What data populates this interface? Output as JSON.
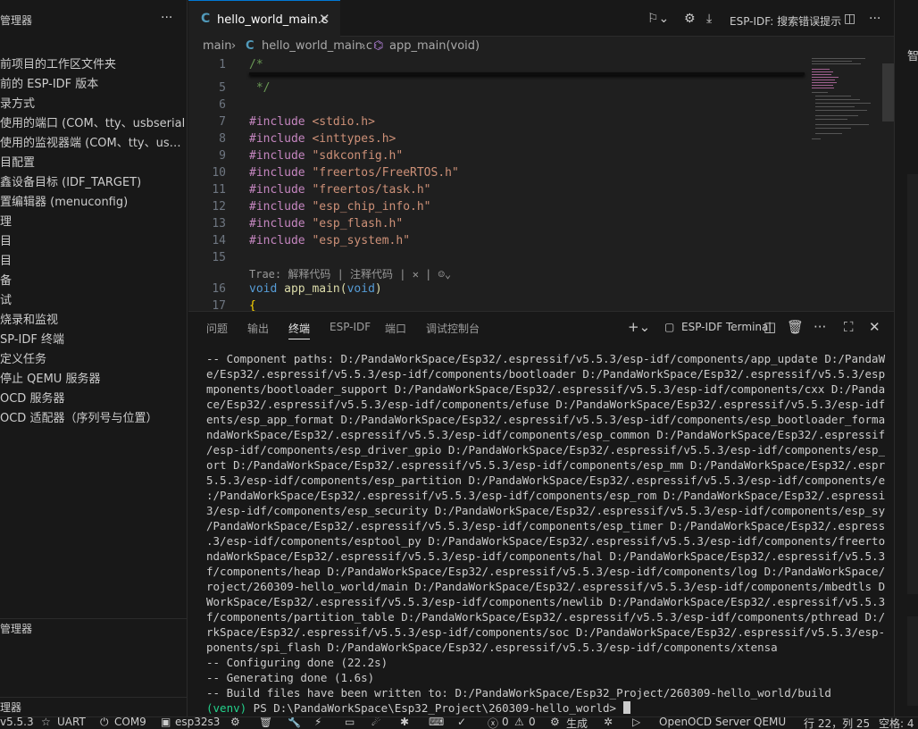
{
  "left_panel": {
    "title": "管理器",
    "more": "···",
    "items": [
      "前项目的工作区文件夹",
      "前的 ESP-IDF 版本",
      "录方式",
      "使用的端口 (COM、tty、usbserial)",
      "使用的监视器端 (COM、tty、us…",
      "目配置",
      "鑫设备目标 (IDF_TARGET)",
      "置编辑器 (menuconfig)",
      "理",
      "目",
      "目",
      "备",
      "试",
      "烧录和监视",
      "SP-IDF 终端",
      "定义任务",
      "停止 QEMU 服务器",
      "OCD 服务器",
      "OCD 适配器（序列号与位置）"
    ],
    "section1": "管理器",
    "section2": "理器"
  },
  "tabs": [
    {
      "label": "hello_world_main.c",
      "icon": "c-file-icon"
    }
  ],
  "toolbar": {
    "esp_idf_label": "ESP-IDF:",
    "search_label": "搜索错误提示"
  },
  "breadcrumb": {
    "folder": "main",
    "file": "hello_world_main.c",
    "symbol": "app_main(void)"
  },
  "editor": {
    "line_numbers": [
      "1",
      "5",
      "6",
      "7",
      "8",
      "9",
      "10",
      "11",
      "12",
      "13",
      "14",
      "15",
      "16",
      "17"
    ],
    "lines": [
      "/*",
      " */",
      "",
      "#include <stdio.h>",
      "#include <inttypes.h>",
      "#include \"sdkconfig.h\"",
      "#include \"freertos/FreeRTOS.h\"",
      "#include \"freertos/task.h\"",
      "#include \"esp_chip_info.h\"",
      "#include \"esp_flash.h\"",
      "#include \"esp_system.h\"",
      "",
      "void app_main(void)",
      "{"
    ],
    "codelens": "Trae: 解释代码 | 注释代码 | ✕ | ☺︎⌄"
  },
  "panel": {
    "tabs": [
      "问题",
      "输出",
      "终端",
      "ESP-IDF",
      "端口",
      "调试控制台"
    ],
    "active_tab": "终端",
    "terminal_name": "ESP-IDF Terminal",
    "terminal_lines": [
      "-- Component paths: D:/PandaWorkSpace/Esp32/.espressif/v5.5.3/esp-idf/components/app_update D:/PandaWorkSpac",
      "e/Esp32/.espressif/v5.5.3/esp-idf/components/bootloader D:/PandaWorkSpace/Esp32/.espressif/v5.5.3/esp-idf/co",
      "mponents/bootloader_support D:/PandaWorkSpace/Esp32/.espressif/v5.5.3/esp-idf/components/cxx D:/PandaWorkSpa",
      "ce/Esp32/.espressif/v5.5.3/esp-idf/components/efuse D:/PandaWorkSpace/Esp32/.espressif/v5.5.3/esp-idf/compon",
      "ents/esp_app_format D:/PandaWorkSpace/Esp32/.espressif/v5.5.3/esp-idf/components/esp_bootloader_format D:/Pa",
      "ndaWorkSpace/Esp32/.espressif/v5.5.3/esp-idf/components/esp_common D:/PandaWorkSpace/Esp32/.espressif/v5.5.3",
      "/esp-idf/components/esp_driver_gpio D:/PandaWorkSpace/Esp32/.espressif/v5.5.3/esp-idf/components/esp_hw_supp",
      "ort D:/PandaWorkSpace/Esp32/.espressif/v5.5.3/esp-idf/components/esp_mm D:/PandaWorkSpace/Esp32/.espressif/v",
      "5.5.3/esp-idf/components/esp_partition D:/PandaWorkSpace/Esp32/.espressif/v5.5.3/esp-idf/components/esp_pm D",
      ":/PandaWorkSpace/Esp32/.espressif/v5.5.3/esp-idf/components/esp_rom D:/PandaWorkSpace/Esp32/.espressif/v5.5.",
      "3/esp-idf/components/esp_security D:/PandaWorkSpace/Esp32/.espressif/v5.5.3/esp-idf/components/esp_system D:",
      "/PandaWorkSpace/Esp32/.espressif/v5.5.3/esp-idf/components/esp_timer D:/PandaWorkSpace/Esp32/.espressif/v5.5",
      ".3/esp-idf/components/esptool_py D:/PandaWorkSpace/Esp32/.espressif/v5.5.3/esp-idf/components/freertos D:/Pa",
      "ndaWorkSpace/Esp32/.espressif/v5.5.3/esp-idf/components/hal D:/PandaWorkSpace/Esp32/.espressif/v5.5.3/esp-id",
      "f/components/heap D:/PandaWorkSpace/Esp32/.espressif/v5.5.3/esp-idf/components/log D:/PandaWorkSpace/Esp32_P",
      "roject/260309-hello_world/main D:/PandaWorkSpace/Esp32/.espressif/v5.5.3/esp-idf/components/mbedtls D:/Panda",
      "WorkSpace/Esp32/.espressif/v5.5.3/esp-idf/components/newlib D:/PandaWorkSpace/Esp32/.espressif/v5.5.3/esp-id",
      "f/components/partition_table D:/PandaWorkSpace/Esp32/.espressif/v5.5.3/esp-idf/components/pthread D:/PandaWo",
      "rkSpace/Esp32/.espressif/v5.5.3/esp-idf/components/soc D:/PandaWorkSpace/Esp32/.espressif/v5.5.3/esp-idf/com",
      "ponents/spi_flash D:/PandaWorkSpace/Esp32/.espressif/v5.5.3/esp-idf/components/xtensa",
      "-- Configuring done (22.2s)",
      "-- Generating done (1.6s)",
      "-- Build files have been written to: D:/PandaWorkSpace/Esp32_Project/260309-hello_world/build"
    ],
    "prompt_venv": "(venv)",
    "prompt_text": " PS D:\\PandaWorkSpace\\Esp32_Project\\260309-hello_world> "
  },
  "right_strip": {
    "label": "智"
  },
  "statusbar": {
    "idf_version": "v5.5.3",
    "uart": "UART",
    "port": "COM9",
    "target": "esp32s3",
    "problems": "0",
    "warnings": "0",
    "build": "生成",
    "openocd": "OpenOCD Server",
    "qemu": "QEMU",
    "position": "行 22，列 25",
    "indent": "空格: 4"
  },
  "colors": {
    "accent": "#0078d4",
    "venv": "#23d18b",
    "keyword": "#c586c0",
    "string": "#ce9178",
    "comment": "#6a9955"
  }
}
